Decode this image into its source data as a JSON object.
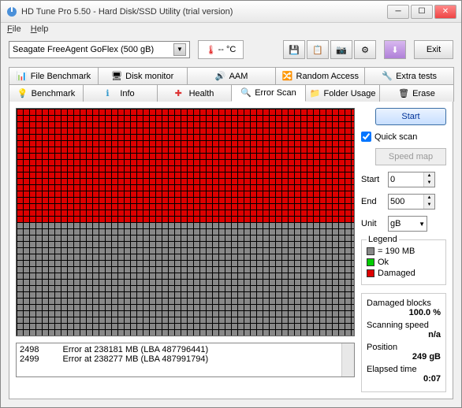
{
  "window": {
    "title": "HD Tune Pro 5.50 - Hard Disk/SSD Utility (trial version)"
  },
  "menu": {
    "file": "File",
    "help": "Help"
  },
  "toolbar": {
    "drive": "Seagate FreeAgent GoFlex (500 gB)",
    "temp": "-- °C",
    "exit": "Exit"
  },
  "tabs": {
    "row1": [
      "File Benchmark",
      "Disk monitor",
      "AAM",
      "Random Access",
      "Extra tests"
    ],
    "row2": [
      "Benchmark",
      "Info",
      "Health",
      "Error Scan",
      "Folder Usage",
      "Erase"
    ],
    "active": "Error Scan"
  },
  "errors": [
    {
      "num": "2498",
      "msg": "Error at 238181 MB (LBA 487796441)"
    },
    {
      "num": "2499",
      "msg": "Error at 238277 MB (LBA 487991794)"
    }
  ],
  "controls": {
    "start": "Start",
    "quickscan": "Quick scan",
    "speedmap": "Speed map",
    "startlbl": "Start",
    "startval": "0",
    "endlbl": "End",
    "endval": "500",
    "unitlbl": "Unit",
    "unitval": "gB"
  },
  "legend": {
    "title": "Legend",
    "block": "= 190 MB",
    "ok": "Ok",
    "damaged": "Damaged"
  },
  "stats": {
    "dblocks_lbl": "Damaged blocks",
    "dblocks_val": "100.0 %",
    "speed_lbl": "Scanning speed",
    "speed_val": "n/a",
    "pos_lbl": "Position",
    "pos_val": "249 gB",
    "time_lbl": "Elapsed time",
    "time_val": "0:07"
  }
}
